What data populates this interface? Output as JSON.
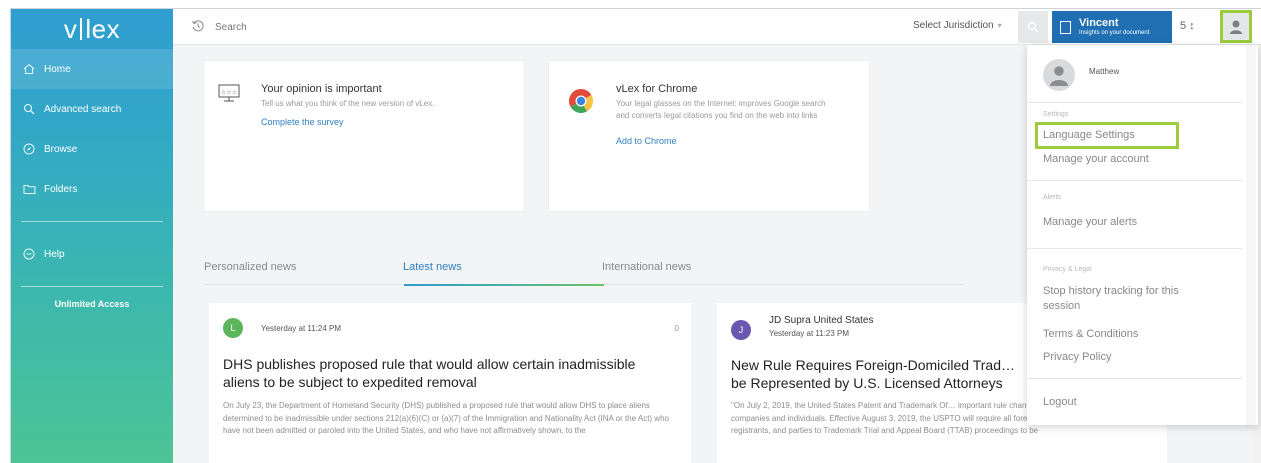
{
  "sidebar": {
    "logo": "vlex",
    "items": [
      {
        "label": "Home",
        "icon": "home-icon"
      },
      {
        "label": "Advanced search",
        "icon": "search-icon"
      },
      {
        "label": "Browse",
        "icon": "compass-icon"
      },
      {
        "label": "Folders",
        "icon": "folder-icon"
      },
      {
        "label": "Help",
        "icon": "help-icon"
      }
    ],
    "unlimited": "Unlimited Access"
  },
  "topbar": {
    "search_placeholder": "Search",
    "jurisdiction": "Select Jurisdiction",
    "vincent_name": "Vincent",
    "vincent_sub": "Insights on your document",
    "counter": "5 ↕"
  },
  "cards": [
    {
      "title": "Your opinion is important",
      "text": "Tell us what you think of the new version of vLex.",
      "link": "Complete the survey",
      "icon": "survey-icon"
    },
    {
      "title": "vLex for Chrome",
      "text": "Your legal glasses on the Internet: improves Google search and converts legal citations you find on the web into links",
      "link": "Add to Chrome",
      "icon": "chrome-icon"
    }
  ],
  "tabs": [
    "Personalized news",
    "Latest news",
    "International news"
  ],
  "news": [
    {
      "avatar_letter": "L",
      "avatar_color": "#5bb55d",
      "time": "Yesterday at 11:24 PM",
      "count": "0",
      "headline": "DHS publishes proposed rule that would allow certain inadmissible aliens to be subject to expedited removal",
      "body": "On July 23, the Department of Homeland Security (DHS) published a proposed rule that would allow DHS to place aliens determined to be inadmissible under sections 212(a)(6)(C) or (a)(7) of the Immigration and Nationality Act (INA or the Act) who have not been admitted or paroled into the United States, and who have not affirmatively shown, to the"
    },
    {
      "avatar_letter": "J",
      "avatar_color": "#6a58b0",
      "source": "JD Supra United States",
      "time": "Yesterday at 11:23 PM",
      "headline": "New Rule Requires Foreign-Domiciled Trad… be Represented by U.S. Licensed Attorneys",
      "body": "\"On July 2, 2019, the United States Patent and Trademark Of… important rule change impacting foreign-domiciled companies and individuals. Effective August 3, 2019, the USPTO will require all foreign-domiciled trademark applicants, registrants, and parties to Trademark Trial and Appeal Board (TTAB) proceedings to be"
    }
  ],
  "dropdown": {
    "user_name": "Matthew",
    "settings_header": "Settings",
    "language_settings": "Language Settings",
    "manage_account": "Manage your account",
    "alerts_header": "Alerts",
    "manage_alerts": "Manage your alerts",
    "privacy_header": "Privacy & Legal",
    "stop_history": "Stop history tracking for this session",
    "terms": "Terms & Conditions",
    "privacy_policy": "Privacy Policy",
    "logout": "Logout"
  },
  "colors": {
    "accent_blue": "#2f7fc1",
    "highlight_green": "#9ccb3b",
    "vincent_blue": "#1f6fb2"
  }
}
